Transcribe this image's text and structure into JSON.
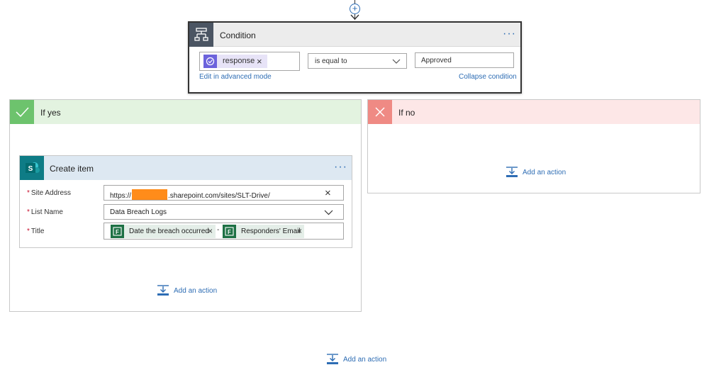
{
  "condition": {
    "title": "Condition",
    "more_label": "···",
    "token_label": "response",
    "token_remove": "×",
    "operator": "is equal to",
    "value": "Approved",
    "advanced_link": "Edit in advanced mode",
    "collapse_link": "Collapse condition"
  },
  "branch_yes": {
    "title": "If yes",
    "card": {
      "title": "Create item",
      "more_label": "···",
      "fields": [
        {
          "label": "Site Address",
          "required": "*",
          "value_prefix": "https://",
          "value_suffix": ".sharepoint.com/sites/SLT-Drive/",
          "clear": "×"
        },
        {
          "label": "List Name",
          "required": "*",
          "value": "Data Breach Logs"
        },
        {
          "label": "Title",
          "required": "*",
          "token1": "Date the breach occurred",
          "separator": "-",
          "token2": "Responders' Email",
          "remove": "×"
        }
      ]
    },
    "add_action": "Add an action"
  },
  "branch_no": {
    "title": "If no",
    "add_action": "Add an action"
  },
  "bottom": {
    "add_action": "Add an action",
    "top_plus": "+"
  },
  "colors": {
    "accent": "#2e6db4",
    "yes": "#6dc36d",
    "no": "#ef8a84",
    "sharepoint": "#0e7c86",
    "forms": "#1e7145",
    "redaction": "#ff8c1a"
  }
}
